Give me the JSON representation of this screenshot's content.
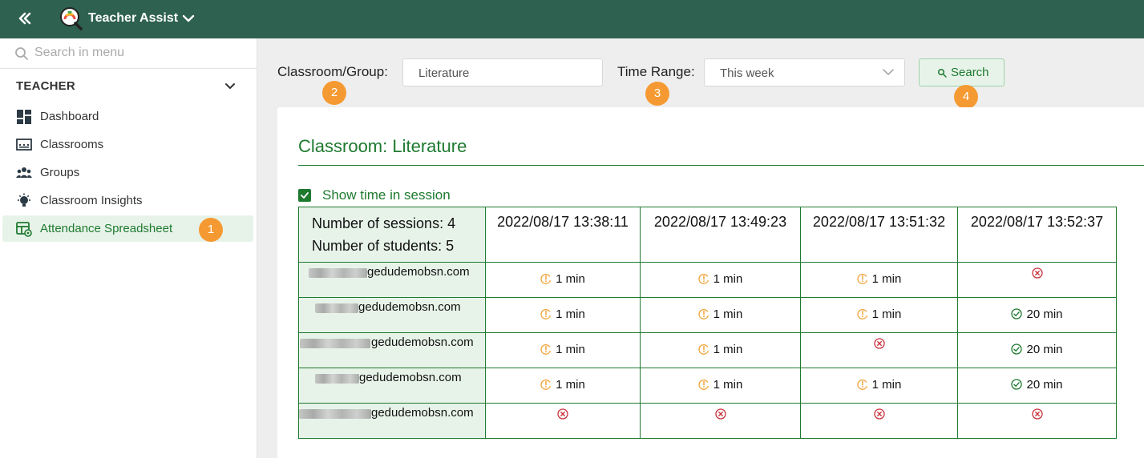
{
  "header": {
    "app_title": "Teacher Assist"
  },
  "sidebar": {
    "search_placeholder": "Search in menu",
    "section_label": "TEACHER",
    "items": [
      {
        "label": "Dashboard",
        "icon": "dashboard-icon"
      },
      {
        "label": "Classrooms",
        "icon": "classroom-icon"
      },
      {
        "label": "Groups",
        "icon": "groups-icon"
      },
      {
        "label": "Classroom Insights",
        "icon": "lightbulb-icon"
      },
      {
        "label": "Attendance Spreadsheet",
        "icon": "spreadsheet-icon",
        "active": true
      }
    ]
  },
  "markers": [
    "1",
    "2",
    "3",
    "4"
  ],
  "filters": {
    "classroom_label": "Classroom/Group:",
    "classroom_value": "Literature",
    "time_label": "Time Range:",
    "time_value": "This week",
    "search_label": "Search"
  },
  "report": {
    "title": "Classroom: Literature",
    "show_time_label": "Show time in session",
    "show_time_checked": true,
    "sessions_text": "Number of sessions: 4",
    "students_text": "Number of students: 5",
    "sessions": [
      "2022/08/17 13:38:11",
      "2022/08/17 13:49:23",
      "2022/08/17 13:51:32",
      "2022/08/17 13:52:37"
    ],
    "rows": [
      {
        "email_domain": "gedudemobsn.com",
        "cells": [
          {
            "status": "warning",
            "text": "1 min"
          },
          {
            "status": "warning",
            "text": "1 min"
          },
          {
            "status": "warning",
            "text": "1 min"
          },
          {
            "status": "absent",
            "text": ""
          }
        ]
      },
      {
        "email_domain": "gedudemobsn.com",
        "cells": [
          {
            "status": "warning",
            "text": "1 min"
          },
          {
            "status": "warning",
            "text": "1 min"
          },
          {
            "status": "warning",
            "text": "1 min"
          },
          {
            "status": "present",
            "text": "20 min"
          }
        ]
      },
      {
        "email_domain": "gedudemobsn.com",
        "cells": [
          {
            "status": "warning",
            "text": "1 min"
          },
          {
            "status": "warning",
            "text": "1 min"
          },
          {
            "status": "absent",
            "text": ""
          },
          {
            "status": "present",
            "text": "20 min"
          }
        ]
      },
      {
        "email_domain": "gedudemobsn.com",
        "cells": [
          {
            "status": "warning",
            "text": "1 min"
          },
          {
            "status": "warning",
            "text": "1 min"
          },
          {
            "status": "warning",
            "text": "1 min"
          },
          {
            "status": "present",
            "text": "20 min"
          }
        ]
      },
      {
        "email_domain": "gedudemobsn.com",
        "cells": [
          {
            "status": "absent",
            "text": ""
          },
          {
            "status": "absent",
            "text": ""
          },
          {
            "status": "absent",
            "text": ""
          },
          {
            "status": "absent",
            "text": ""
          }
        ]
      }
    ]
  },
  "colors": {
    "header_bg": "#2e6150",
    "accent": "#1e7a2f",
    "marker": "#f59a32",
    "warning": "#f2a33a",
    "absent": "#c8323c",
    "present": "#1e7a2f"
  }
}
